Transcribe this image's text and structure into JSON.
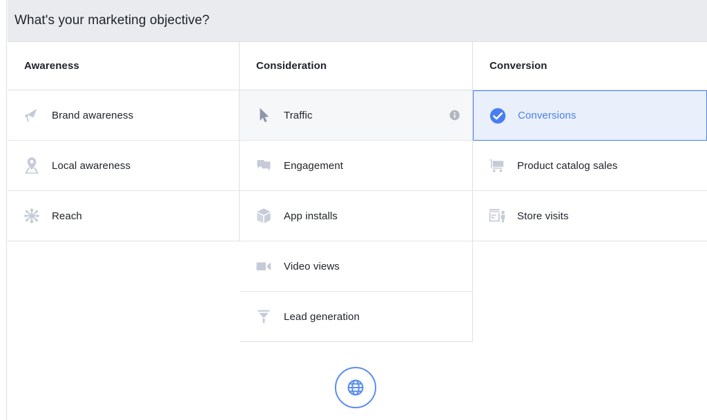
{
  "header": {
    "title": "What's your marketing objective?",
    "background_color": "#e9ebee"
  },
  "theme": {
    "accent_blue": "#4a7ef0",
    "selected_background": "#e9effb",
    "hover_background": "#f6f7f9",
    "icon_color": "#c5cbd8",
    "text_color": "#1d2129",
    "border_color": "#dddfe2"
  },
  "columns": [
    {
      "key": "awareness",
      "title": "Awareness",
      "options": [
        {
          "label": "Brand awareness",
          "icon": "megaphone-icon",
          "state": "default"
        },
        {
          "label": "Local awareness",
          "icon": "map-pin-icon",
          "state": "default"
        },
        {
          "label": "Reach",
          "icon": "starburst-icon",
          "state": "default"
        }
      ]
    },
    {
      "key": "consideration",
      "title": "Consideration",
      "options": [
        {
          "label": "Traffic",
          "icon": "cursor-arrow-icon",
          "state": "hovered",
          "info": true
        },
        {
          "label": "Engagement",
          "icon": "speech-bubbles-icon",
          "state": "default"
        },
        {
          "label": "App installs",
          "icon": "cube-icon",
          "state": "default"
        },
        {
          "label": "Video views",
          "icon": "video-camera-icon",
          "state": "default"
        },
        {
          "label": "Lead generation",
          "icon": "funnel-icon",
          "state": "default"
        }
      ]
    },
    {
      "key": "conversion",
      "title": "Conversion",
      "options": [
        {
          "label": "Conversions",
          "icon": "check-circle-icon",
          "state": "selected"
        },
        {
          "label": "Product catalog sales",
          "icon": "shopping-cart-icon",
          "state": "default"
        },
        {
          "label": "Store visits",
          "icon": "storefront-icon",
          "state": "default"
        }
      ]
    }
  ],
  "footer": {
    "globe_button_icon": "globe-icon"
  }
}
